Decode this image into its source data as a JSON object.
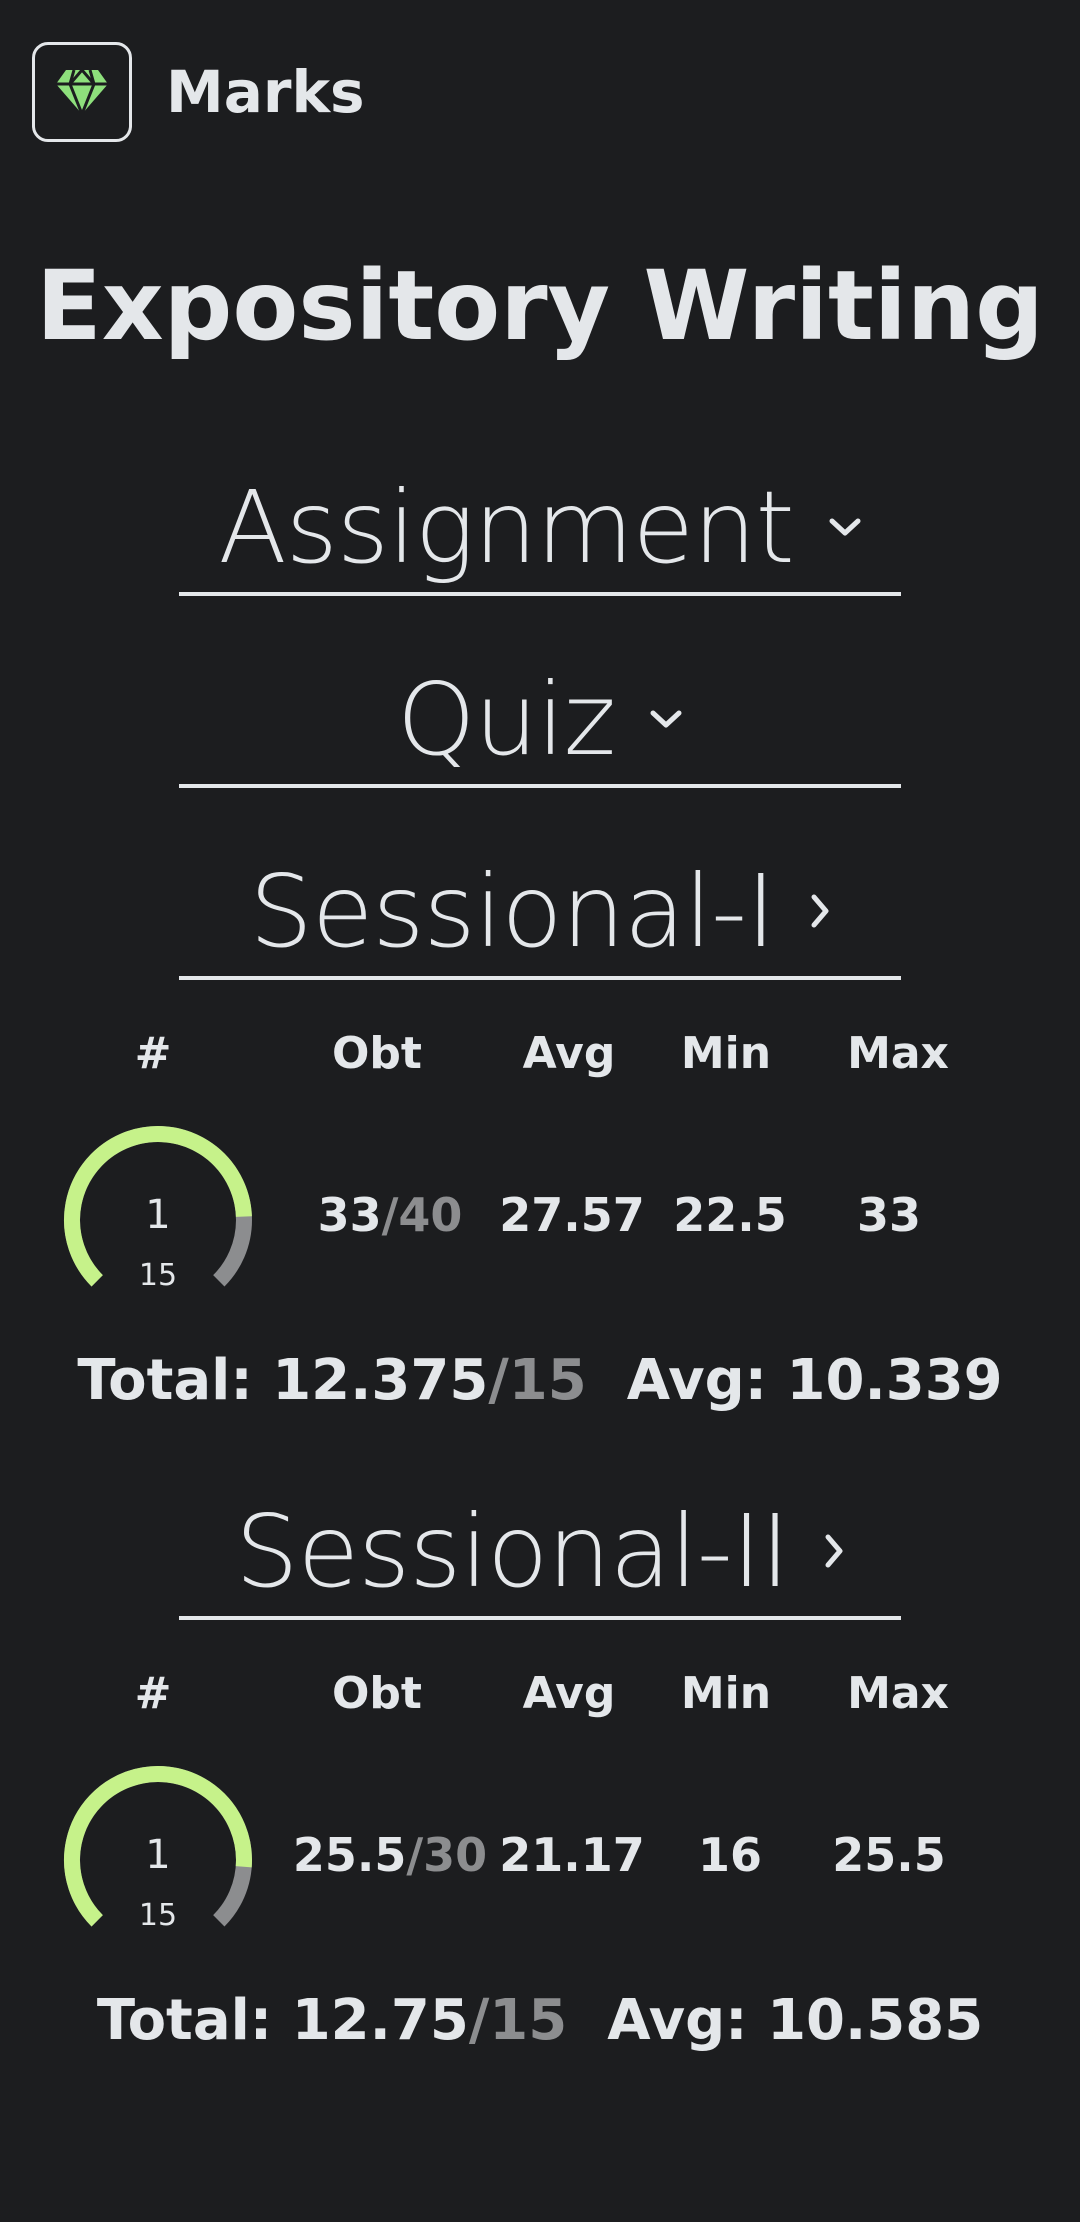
{
  "header": {
    "title": "Marks",
    "logo_icon": "diamond-icon"
  },
  "course": {
    "title": "Expository Writing"
  },
  "sections": {
    "assignment": {
      "label": "Assignment",
      "icon": "chevron-down-icon"
    },
    "quiz": {
      "label": "Quiz",
      "icon": "chevron-down-icon"
    },
    "sessional1": {
      "label": "Sessional-I",
      "icon": "chevron-right-icon",
      "columns": [
        "#",
        "Obt",
        "Avg",
        "Min",
        "Max"
      ],
      "row": {
        "num": "1",
        "weight": "15",
        "obt": "33",
        "obt_total": "/40",
        "avg": "27.57",
        "min": "22.5",
        "max": "33",
        "fraction": 0.825
      },
      "total": {
        "label": "Total: ",
        "value": "12.375",
        "out_of": "/15",
        "avg_label": "Avg: ",
        "avg_value": "10.339"
      }
    },
    "sessional2": {
      "label": "Sessional-II",
      "icon": "chevron-right-icon",
      "columns": [
        "#",
        "Obt",
        "Avg",
        "Min",
        "Max"
      ],
      "row": {
        "num": "1",
        "weight": "15",
        "obt": "25.5",
        "obt_total": "/30",
        "avg": "21.17",
        "min": "16",
        "max": "25.5",
        "fraction": 0.85
      },
      "total": {
        "label": "Total: ",
        "value": "12.75",
        "out_of": "/15",
        "avg_label": "Avg: ",
        "avg_value": "10.585"
      }
    }
  },
  "colors": {
    "background": "#1c1d1f",
    "text": "#e4e7ea",
    "accent": "#c6f28a",
    "muted": "#8c8d8f",
    "logo": "#8ee07c"
  }
}
